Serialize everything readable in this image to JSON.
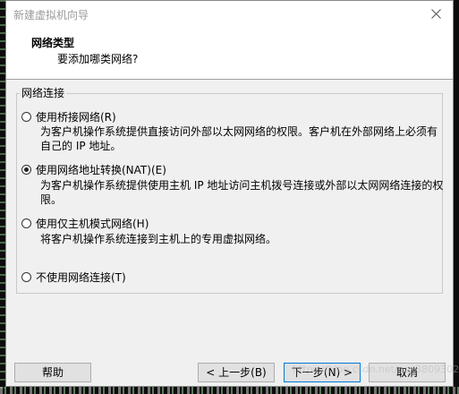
{
  "window": {
    "title": "新建虚拟机向导"
  },
  "header": {
    "title": "网络类型",
    "subtitle": "要添加哪类网络?"
  },
  "group": {
    "legend": "网络连接",
    "options": [
      {
        "label": "使用桥接网络(R)",
        "description": "为客户机操作系统提供直接访问外部以太网网络的权限。客户机在外部网络上必须有自己的 IP 地址。",
        "checked": false
      },
      {
        "label": "使用网络地址转换(NAT)(E)",
        "description": "为客户机操作系统提供使用主机 IP 地址访问主机拨号连接或外部以太网网络连接的权限。",
        "checked": true
      },
      {
        "label": "使用仅主机模式网络(H)",
        "description": "将客户机操作系统连接到主机上的专用虚拟网络。",
        "checked": false
      },
      {
        "label": "不使用网络连接(T)",
        "description": "",
        "checked": false
      }
    ]
  },
  "buttons": {
    "help": "帮助",
    "back": "< 上一步(B)",
    "next": "下一步(N) >",
    "cancel": "取消"
  },
  "watermark": "https://blog.csdn.net/qq_38093025",
  "colors": {
    "dialog_bg": "#f0f0f0",
    "header_bg": "#ffffff",
    "focus_border": "#0078d7",
    "title_text": "#9a9a9a"
  },
  "icons": {
    "close": "close-icon"
  }
}
